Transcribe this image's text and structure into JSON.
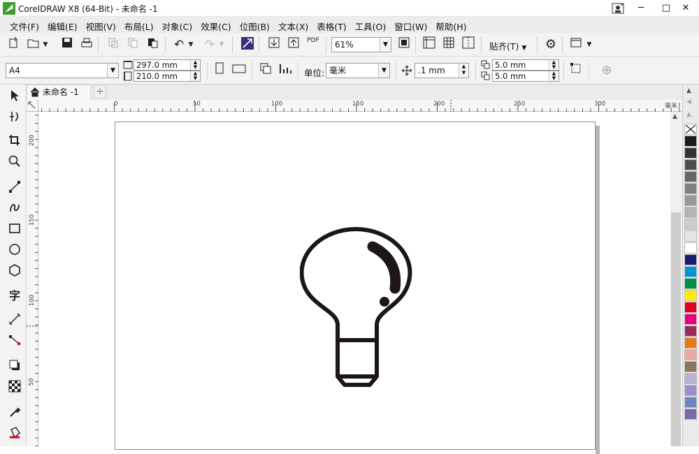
{
  "window": {
    "title": "CorelDRAW X8 (64-Bit) - 未命名 -1",
    "controls": [
      "─",
      "□",
      "✕"
    ]
  },
  "menubar": {
    "items": [
      "文件(F)",
      "编辑(E)",
      "视图(V)",
      "布局(L)",
      "对象(C)",
      "效果(C)",
      "位图(B)",
      "文本(X)",
      "表格(T)",
      "工具(O)",
      "窗口(W)",
      "帮助(H)"
    ]
  },
  "standard_toolbar": {
    "zoom_value": "61%",
    "snap_label": "贴齐(T)",
    "pdf_label": "PDF"
  },
  "property_bar": {
    "page_size": "A4",
    "width": "297.0 mm",
    "height": "210.0 mm",
    "units_label": "单位:",
    "units_value": "毫米",
    "nudge": ".1 mm",
    "dup_x": "5.0 mm",
    "dup_y": "5.0 mm"
  },
  "document_tabs": {
    "active_tab": "未命名 -1",
    "add_tab": "+"
  },
  "horizontal_ruler": {
    "labels": [
      "0",
      "50",
      "100",
      "150",
      "200",
      "250",
      "300"
    ],
    "unit": "毫米"
  },
  "vertical_ruler": {
    "labels": [
      "200",
      "150",
      "100",
      "50"
    ]
  },
  "toolbox": {
    "text_tool_glyph": "字"
  },
  "palette": {
    "colors": [
      "#1a1a1a",
      "#333333",
      "#4d4d4d",
      "#666666",
      "#808080",
      "#999999",
      "#b3b3b3",
      "#cccccc",
      "#e6e6e6",
      "#ffffff",
      "#1b1a6e",
      "#0096d6",
      "#00904a",
      "#ffee00",
      "#e2001a",
      "#e4007f",
      "#9a2a5c",
      "#e87a12",
      "#eba7a2",
      "#8a7563",
      "#b9b2d4",
      "#9b8fc7",
      "#6d86c4",
      "#7b6aa8"
    ]
  },
  "artwork": {
    "description_icon": "lightbulb-icon",
    "stroke_color": "#1c1616"
  }
}
